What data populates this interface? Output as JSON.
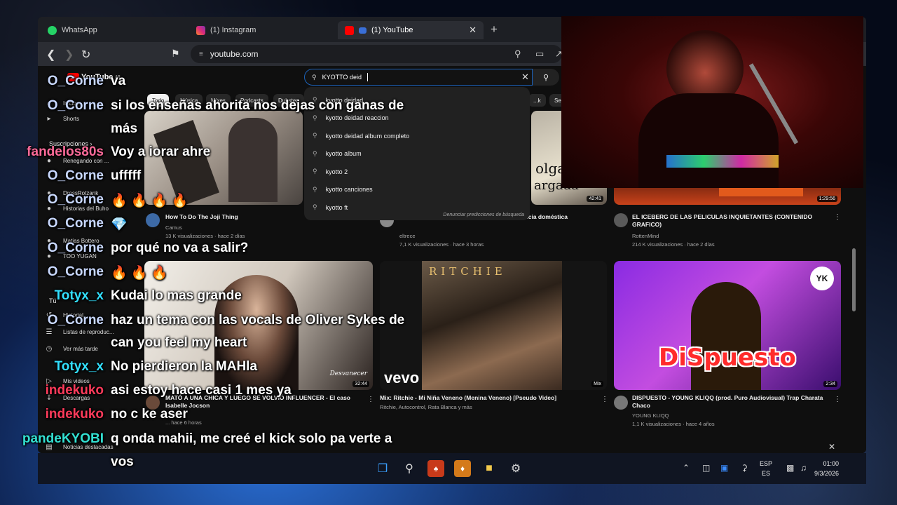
{
  "browser": {
    "tabs": [
      {
        "label": "WhatsApp"
      },
      {
        "label": "(1) Instagram"
      },
      {
        "label": "(1) YouTube"
      }
    ],
    "url": "youtube.com"
  },
  "youtube": {
    "logo": "YouTube",
    "region": "AR",
    "search": {
      "value": "KYOTTO deid",
      "suggestions": [
        "kyotto deidad",
        "kyotto deidad reaccion",
        "kyotto deidad album completo",
        "kyotto album",
        "kyotto 2",
        "kyotto canciones",
        "kyotto ft"
      ],
      "report": "Denunciar predicciones de búsqueda"
    },
    "chips": [
      "Todo",
      "Música",
      "Mixes",
      "Podcasts",
      "Dubstep",
      "...k",
      "Ser"
    ],
    "sidebar": {
      "inicio": "Inicio",
      "shorts": "Shorts",
      "subscriptions": "Suscripciones",
      "channels": [
        "Renegando con ...",
        "DrossRotzank",
        "Historias del Buho",
        "Matias Bottero",
        "TOO YUGAN"
      ],
      "you": "Tú",
      "history": "Historial",
      "playlists": "Listas de reproduc...",
      "watch_later": "Ver más tarde",
      "your_videos": "Mis videos",
      "downloads": "Descargas",
      "news": "Noticias destacadas"
    },
    "videos_row1": [
      {
        "title": "How To Do The Joji Thing",
        "channel": "Camus",
        "stats": "13 K visualizaciones · hace 2 días",
        "duration": ""
      },
      {
        "title": "...ada, en una vida que no quiere, sufre violencia doméstica",
        "channel": "eltrece",
        "stats": "7,1 K visualizaciones · hace 3 horas",
        "duration": "42:41"
      },
      {
        "title": "EL ICEBERG DE LAS PELICULAS INQUIETANTES (CONTENIDO GRAFICO)",
        "channel": "RottenMind",
        "stats": "214 K visualizaciones · hace 2 días",
        "duration": "1:29:56"
      }
    ],
    "videos_row2": [
      {
        "title": "MATÓ A UNA CHICA Y LUEGO SE VOLVIÓ INFLUENCER - El caso Isabelle Jocson",
        "channel": "...logs",
        "stats": "... hace 6 horas",
        "duration": "32:44",
        "overlay": "Desvanecer"
      },
      {
        "title": "Mix: Ritchie - Mi Niña Veneno (Menina Veneno) [Pseudo Video]",
        "channel": "Ritchie, Autocontrol, Rata Blanca y más",
        "stats": "",
        "duration": "Mix",
        "art_title": "RITCHIE",
        "brand": "vevo"
      },
      {
        "title": "DISPUESTO - YOUNG KLIQQ (prod. Puro Audiovisual) Trap Charata Chaco",
        "channel": "YOUNG KLIQQ",
        "stats": "1,1 K visualizaciones · hace 4 años",
        "duration": "2:34",
        "art_title": "DiSpuesto",
        "badge": "YK"
      }
    ],
    "partial_titles": [
      "olga",
      "argada"
    ]
  },
  "chat": [
    {
      "user": "O_Corne",
      "msg": "va",
      "color": "#c8d8ff"
    },
    {
      "user": "O_Corne",
      "msg": "si los enseñas ahorita nos dejas con ganas de",
      "color": "#c8d8ff"
    },
    {
      "user": "",
      "msg": "más",
      "color": "#c8d8ff"
    },
    {
      "user": "fandelos80s",
      "msg": "Voy a iorar ahre",
      "color": "#ff6b9a"
    },
    {
      "user": "O_Corne",
      "msg": "ufffff",
      "color": "#c8d8ff"
    },
    {
      "user": "O_Corne",
      "msg": "🔥 🔥 🔥 🔥",
      "color": "#c8d8ff"
    },
    {
      "user": "O_Corne",
      "msg": "💎",
      "color": "#c8d8ff"
    },
    {
      "user": "O_Corne",
      "msg": "por qué no va a salir?",
      "color": "#c8d8ff"
    },
    {
      "user": "O_Corne",
      "msg": "🔥 🔥 🔥",
      "color": "#c8d8ff"
    },
    {
      "user": "Totyx_x",
      "msg": "Kudai lo mas grande",
      "color": "#33e0ff"
    },
    {
      "user": "O_Corne",
      "msg": "haz un tema con las vocals de Oliver Sykes de",
      "color": "#c8d8ff"
    },
    {
      "user": "",
      "msg": "can you feel my heart",
      "color": "#c8d8ff"
    },
    {
      "user": "Totyx_x",
      "msg": "No pierdieron la MAHla",
      "color": "#33e0ff"
    },
    {
      "user": "indekuko",
      "msg": "asi estoy hace casi 1 mes ya",
      "color": "#ff3b5b"
    },
    {
      "user": "indekuko",
      "msg": "no c ke aser",
      "color": "#ff3b5b"
    },
    {
      "user": "pandeKYOBI",
      "msg": "q onda mahii, me creé el kick solo pa verte a",
      "color": "#33e0d2"
    },
    {
      "user": "",
      "msg": "vos",
      "color": "#33e0d2"
    }
  ],
  "taskbar": {
    "lang_top": "ESP",
    "lang_bottom": "ES",
    "time": "01:00",
    "date": "9/3/2026"
  },
  "colors": {
    "yt_red": "#ff0000",
    "search_focus": "#1c62b9",
    "chip_active": "#f1f1f1"
  }
}
